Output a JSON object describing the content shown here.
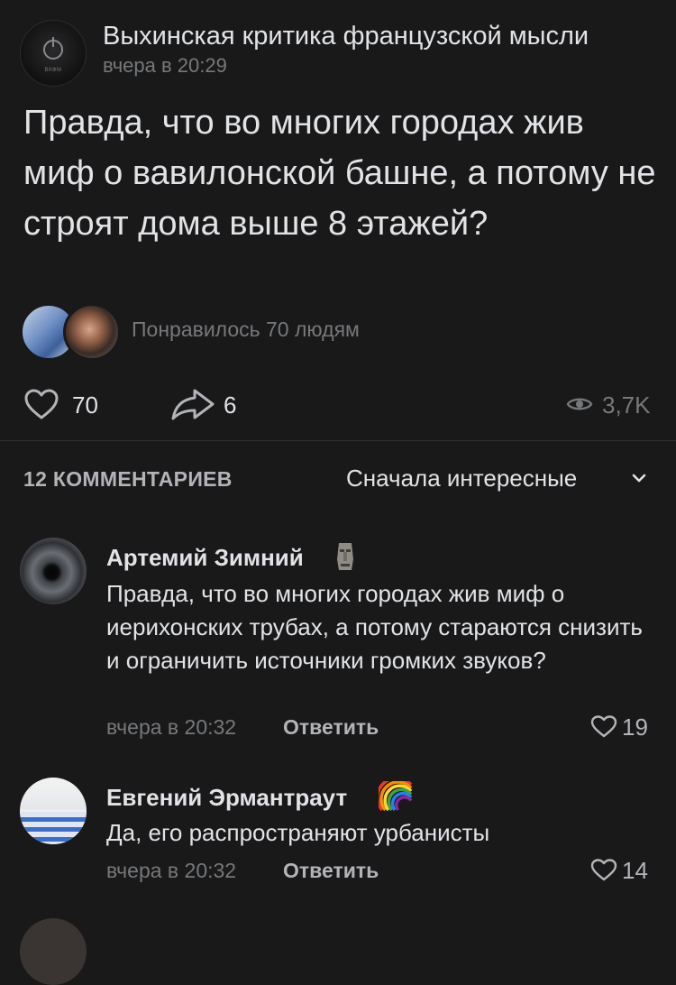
{
  "post": {
    "group_name": "Выхинская критика французской мысли",
    "group_avatar_tag": "ВКФМ",
    "time": "вчера в 20:29",
    "text": "Правда, что во многих городах жив миф о вавилонской башне, а потому не строят дома выше 8 этажей?",
    "liked_by": "Понравилось 70 людям",
    "likes": "70",
    "shares": "6",
    "views": "3,7K"
  },
  "comments_section": {
    "title": "12 КОММЕНТАРИЕВ",
    "sort_label": "Сначала интересные"
  },
  "comments": [
    {
      "author": "Артемий Зимний",
      "text": "Правда, что во многих городах жив миф о иерихонских трубах, а потому стараются снизить и ограничить источники громких звуков?",
      "time": "вчера в 20:32",
      "reply_label": "Ответить",
      "likes": "19",
      "badge_icon": "moai-emoji"
    },
    {
      "author": "Евгений Эрмантраут",
      "text": "Да, его распространяют урбанисты",
      "time": "вчера в 20:32",
      "reply_label": "Ответить",
      "likes": "14",
      "badge_icon": "rainbow-emoji"
    }
  ],
  "colors": {
    "background": "#19191a",
    "text_primary": "#e1e3e6",
    "text_secondary": "#76787a"
  }
}
